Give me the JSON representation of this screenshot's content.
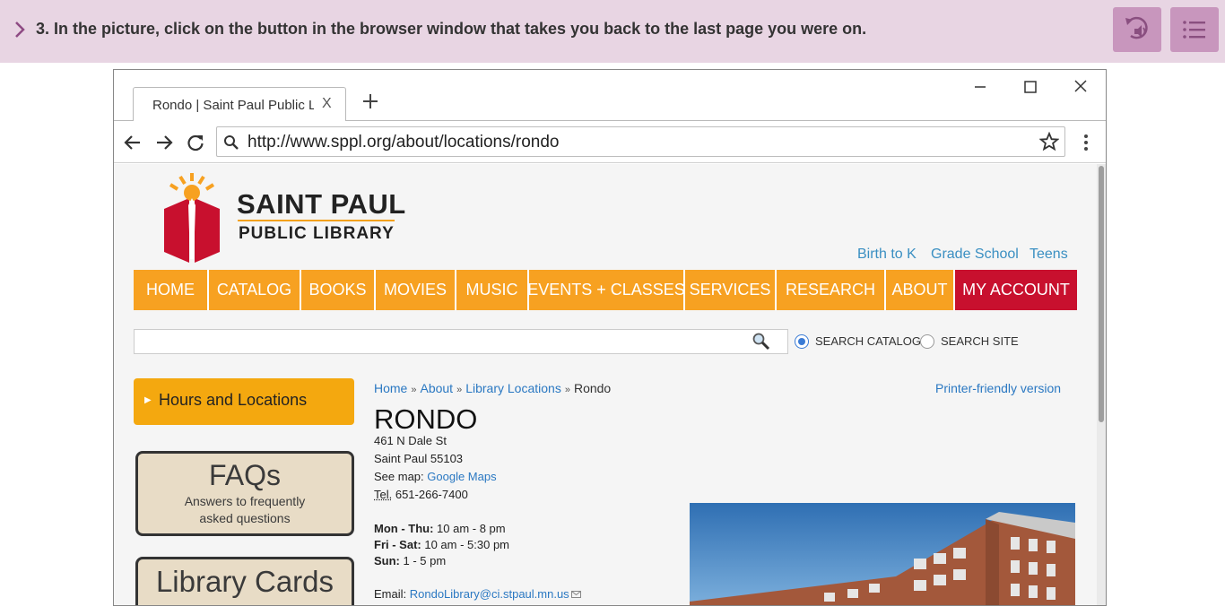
{
  "question": {
    "text": "3. In the picture, click on the button in the browser window that takes you back to the last page you were on.",
    "icons": [
      "chevron-right-icon",
      "replay-audio-icon",
      "list-menu-icon"
    ]
  },
  "browser": {
    "tab_title": "Rondo | Saint Paul Public Li",
    "tab_close": "X",
    "url": "http://www.sppl.org/about/locations/rondo"
  },
  "site": {
    "brand_line1": "SAINT PAUL",
    "brand_line2": "PUBLIC LIBRARY",
    "audience_links": [
      "Birth to K",
      "Grade School",
      "Teens"
    ],
    "nav": [
      "HOME",
      "CATALOG",
      "BOOKS",
      "MOVIES",
      "MUSIC",
      "EVENTS + CLASSES",
      "SERVICES",
      "RESEARCH",
      "ABOUT",
      "MY ACCOUNT"
    ],
    "search": {
      "option1": "SEARCH CATALOG",
      "option2": "SEARCH SITE",
      "selected": "SEARCH CATALOG"
    },
    "sidebar": {
      "hours_label": "Hours and Locations",
      "faq_title": "FAQs",
      "faq_sub1": "Answers to frequently",
      "faq_sub2": "asked questions",
      "cards_title": "Library Cards"
    },
    "breadcrumb": {
      "home": "Home",
      "about": "About",
      "locations": "Library Locations",
      "current": "Rondo",
      "separator": "»"
    },
    "printer_link": "Printer-friendly version",
    "page_title": "RONDO",
    "address1": "461 N Dale St",
    "address2": "Saint Paul 55103",
    "see_map_label": "See map: ",
    "see_map_link": "Google Maps",
    "tel_label": "Tel.",
    "tel_value": " 651-266-7400",
    "hours": [
      {
        "days": "Mon - Thu:",
        "time": " 10 am - 8 pm"
      },
      {
        "days": "Fri - Sat:",
        "time": " 10 am - 5:30 pm"
      },
      {
        "days": "Sun:",
        "time": " 1 - 5 pm"
      }
    ],
    "email_label": "Email: ",
    "email_value": "RondoLibrary@ci.stpaul.mn.us"
  },
  "colors": {
    "question_bar": "#e8d5e3",
    "question_buttons": "#c896bd",
    "nav_orange": "#f7a121",
    "account_red": "#c8102e",
    "link_blue": "#2a78c2"
  }
}
